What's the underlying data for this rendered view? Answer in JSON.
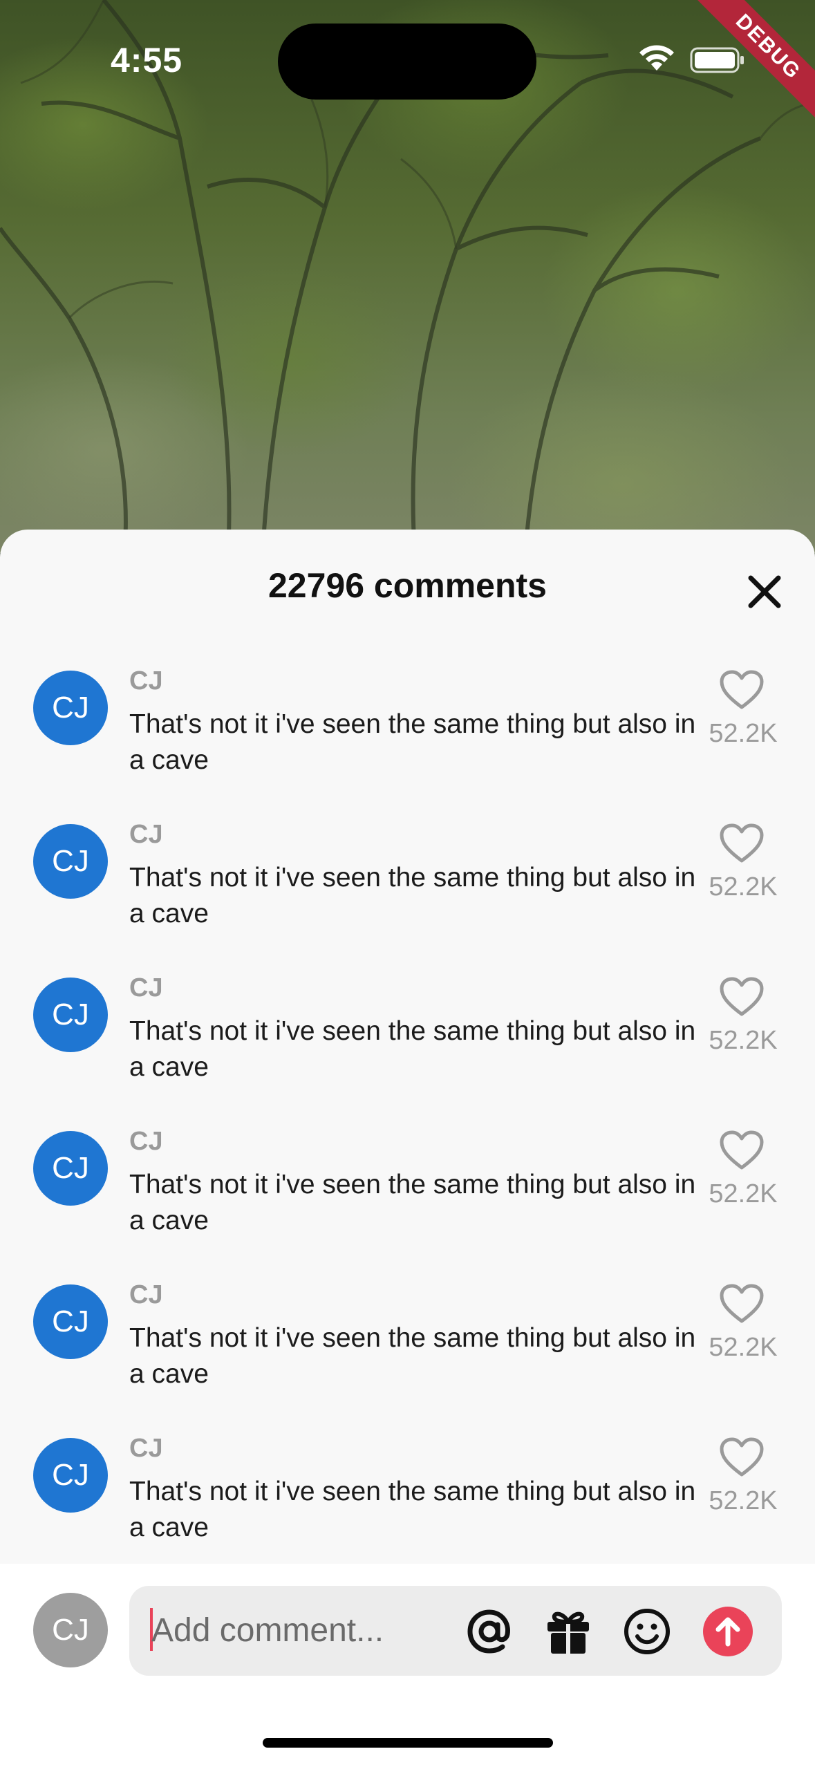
{
  "status_bar": {
    "time": "4:55",
    "debug_banner": "DEBUG"
  },
  "sheet": {
    "title": "22796 comments"
  },
  "comments": [
    {
      "avatar_initials": "CJ",
      "username": "CJ",
      "text": "That's not it i've seen the same thing but also in a cave",
      "likes": "52.2K"
    },
    {
      "avatar_initials": "CJ",
      "username": "CJ",
      "text": "That's not it i've seen the same thing but also in a cave",
      "likes": "52.2K"
    },
    {
      "avatar_initials": "CJ",
      "username": "CJ",
      "text": "That's not it i've seen the same thing but also in a cave",
      "likes": "52.2K"
    },
    {
      "avatar_initials": "CJ",
      "username": "CJ",
      "text": "That's not it i've seen the same thing but also in a cave",
      "likes": "52.2K"
    },
    {
      "avatar_initials": "CJ",
      "username": "CJ",
      "text": "That's not it i've seen the same thing but also in a cave",
      "likes": "52.2K"
    },
    {
      "avatar_initials": "CJ",
      "username": "CJ",
      "text": "That's not it i've seen the same thing but also in a cave",
      "likes": "52.2K"
    }
  ],
  "composer": {
    "avatar_initials": "CJ",
    "placeholder": "Add comment...",
    "icons": [
      "at-icon",
      "gift-icon",
      "emoji-icon",
      "send-arrow-icon"
    ]
  },
  "colors": {
    "avatar_blue": "#1f76d2",
    "accent_red": "#ea4359",
    "sheet_bg": "#f8f8f8",
    "muted_text": "#9a9a9a"
  }
}
